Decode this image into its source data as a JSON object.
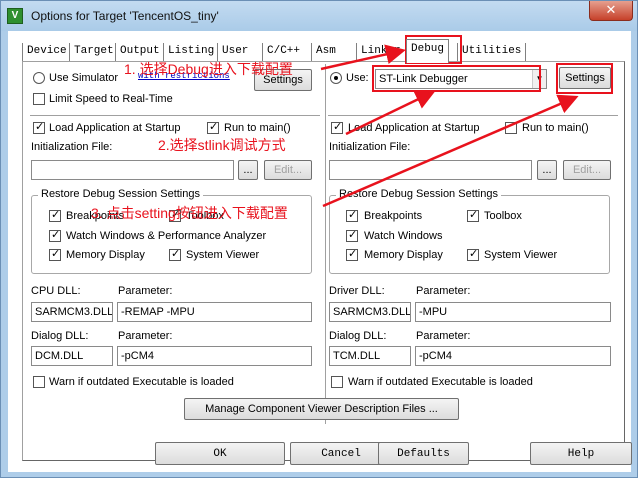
{
  "window": {
    "title": "Options for Target 'TencentOS_tiny'",
    "close_glyph": "✕",
    "icon_glyph": "V"
  },
  "tabs": [
    {
      "label": "Device",
      "active": false
    },
    {
      "label": "Target",
      "active": false
    },
    {
      "label": "Output",
      "active": false
    },
    {
      "label": "Listing",
      "active": false
    },
    {
      "label": "User",
      "active": false
    },
    {
      "label": "C/C++",
      "active": false
    },
    {
      "label": "Asm",
      "active": false
    },
    {
      "label": "Linker",
      "active": false
    },
    {
      "label": "Debug",
      "active": true
    },
    {
      "label": "Utilities",
      "active": false
    }
  ],
  "left": {
    "use_simulator": {
      "label": "Use Simulator",
      "checked": false
    },
    "with_restrictions": "with restrictions",
    "settings_label": "Settings",
    "limit_speed": {
      "label": "Limit Speed to Real-Time",
      "checked": false
    },
    "load_app": {
      "label": "Load Application at Startup",
      "checked": true
    },
    "run_to_main": {
      "label": "Run to main()",
      "checked": true
    },
    "init_file_label": "Initialization File:",
    "init_file_value": "",
    "browse_label": "...",
    "edit_label": "Edit...",
    "restore_group": "Restore Debug Session Settings",
    "breakpoints": {
      "label": "Breakpoints",
      "checked": true
    },
    "toolbox": {
      "label": "Toolbox",
      "checked": true
    },
    "watch_windows": {
      "label": "Watch Windows & Performance Analyzer",
      "checked": true
    },
    "memory_display": {
      "label": "Memory Display",
      "checked": true
    },
    "system_viewer": {
      "label": "System Viewer",
      "checked": true
    },
    "dll_label": "CPU DLL:",
    "dll_param_label": "Parameter:",
    "dll_value": "SARMCM3.DLL",
    "dll_param_value": "-REMAP -MPU",
    "dialog_dll_label": "Dialog DLL:",
    "dialog_param_label": "Parameter:",
    "dialog_dll_value": "DCM.DLL",
    "dialog_param_value": "-pCM4",
    "warn": {
      "label": "Warn if outdated Executable is loaded",
      "checked": false
    }
  },
  "right": {
    "use": {
      "label": "Use:",
      "checked": true
    },
    "debugger": "ST-Link Debugger",
    "settings_label": "Settings",
    "load_app": {
      "label": "Load Application at Startup",
      "checked": true
    },
    "run_to_main": {
      "label": "Run to main()",
      "checked": false
    },
    "init_file_label": "Initialization File:",
    "init_file_value": "",
    "browse_label": "...",
    "edit_label": "Edit...",
    "restore_group": "Restore Debug Session Settings",
    "breakpoints": {
      "label": "Breakpoints",
      "checked": true
    },
    "toolbox": {
      "label": "Toolbox",
      "checked": true
    },
    "watch_windows": {
      "label": "Watch Windows",
      "checked": true
    },
    "memory_display": {
      "label": "Memory Display",
      "checked": true
    },
    "system_viewer": {
      "label": "System Viewer",
      "checked": true
    },
    "dll_label": "Driver DLL:",
    "dll_param_label": "Parameter:",
    "dll_value": "SARMCM3.DLL",
    "dll_param_value": "-MPU",
    "dialog_dll_label": "Dialog DLL:",
    "dialog_param_label": "Parameter:",
    "dialog_dll_value": "TCM.DLL",
    "dialog_param_value": "-pCM4",
    "warn": {
      "label": "Warn if outdated Executable is loaded",
      "checked": false
    }
  },
  "manage_label": "Manage Component Viewer Description Files ...",
  "footer": {
    "ok": "OK",
    "cancel": "Cancel",
    "defaults": "Defaults",
    "help": "Help"
  },
  "annotations": {
    "step1": "1. 选择Debug进入下载配置",
    "step2": "2.选择stlink调试方式",
    "step3": "3. 点击setting按钮进入下载配置",
    "color": "#e8121d"
  }
}
